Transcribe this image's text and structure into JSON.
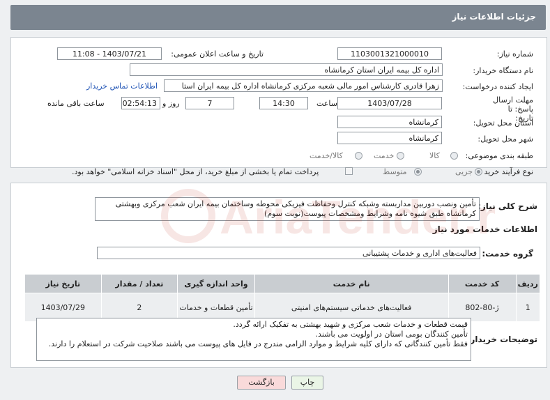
{
  "header": {
    "title": "جزئیات اطلاعات نیاز"
  },
  "form": {
    "need_number_label": "شماره نیاز:",
    "need_number": "1103001321000010",
    "announce_label": "تاریخ و ساعت اعلان عمومی:",
    "announce_value": "1403/07/21 - 11:08",
    "buyer_label": "نام دستگاه خریدار:",
    "buyer_value": "اداره کل بیمه ایران استان کرمانشاه",
    "creator_label": "ایجاد کننده درخواست:",
    "creator_value": "زهرا قادری کارشناس امور مالی شعبه مرکزی کرمانشاه اداره کل بیمه ایران استا",
    "contact_link": "اطلاعات تماس خریدار",
    "deadline_label": "مهلت ارسال پاسخ: تا تاریخ:",
    "deadline_date": "1403/07/28",
    "time_label": "ساعت",
    "deadline_time": "14:30",
    "days_value": "7",
    "days_label": "روز و",
    "remaining_value": "02:54:13",
    "remaining_label": "ساعت باقی مانده",
    "province_label": "استان محل تحویل:",
    "province_value": "کرمانشاه",
    "city_label": "شهر محل تحویل:",
    "city_value": "کرمانشاه",
    "category_label": "طبقه بندی موضوعی:",
    "category_options": [
      "کالا",
      "خدمت",
      "کالا/خدمت"
    ],
    "process_label": "نوع فرآیند خرید :",
    "process_options": [
      "جزیی",
      "متوسط"
    ],
    "payment_note": "پرداخت تمام یا بخشی از مبلغ خرید، از محل \"اسناد خزانه اسلامی\" خواهد بود."
  },
  "summary": {
    "label": "شرح کلی نیاز:",
    "text": "تأمین ونصب دوربین مداربسته وشبکه کنترل وحفاظت فیزیکی محوطه وساختمان بیمه ایران شعب مرکزی وبهشتی کرمانشاه طبق شیوه نامه وشرایط ومشخصات پیوست(نوبت سوم)"
  },
  "services": {
    "title": "اطلاعات خدمات مورد نیاز",
    "group_label": "گروه خدمت:",
    "group_value": "فعالیت‌های اداری و خدمات پشتیبانی",
    "columns": [
      "ردیف",
      "کد خدمت",
      "نام خدمت",
      "واحد اندازه گیری",
      "تعداد / مقدار",
      "تاریخ نیاز"
    ],
    "rows": [
      {
        "row": "1",
        "code": "ژ-80-802",
        "name": "فعالیت‌های خدماتی سیستم‌های امنیتی",
        "unit": "تأمین قطعات و خدمات",
        "qty": "2",
        "date": "1403/07/29"
      }
    ]
  },
  "buyer_notes": {
    "label": "توضیحات خریدار:",
    "lines": [
      "قیمت قطعات و خدمات شعب مرکزی و شهید بهشتی به تفکیک ارائه گردد.",
      "تأمین کنندگان بومی استان در اولویت می باشند.",
      "فقط تأمین کنندگانی که دارای کلیه شرایط و موارد الزامی مندرج در فایل های پیوست می باشند صلاحیت شرکت در استعلام را دارند."
    ]
  },
  "buttons": {
    "print": "چاپ",
    "back": "بازگشت"
  },
  "watermark": {
    "text": "AriaTender.neT"
  },
  "colors": {
    "header": "#7b8590",
    "link": "#1a4fb3",
    "back_button": "#f9dada",
    "print_button": "#eaf5e6"
  }
}
